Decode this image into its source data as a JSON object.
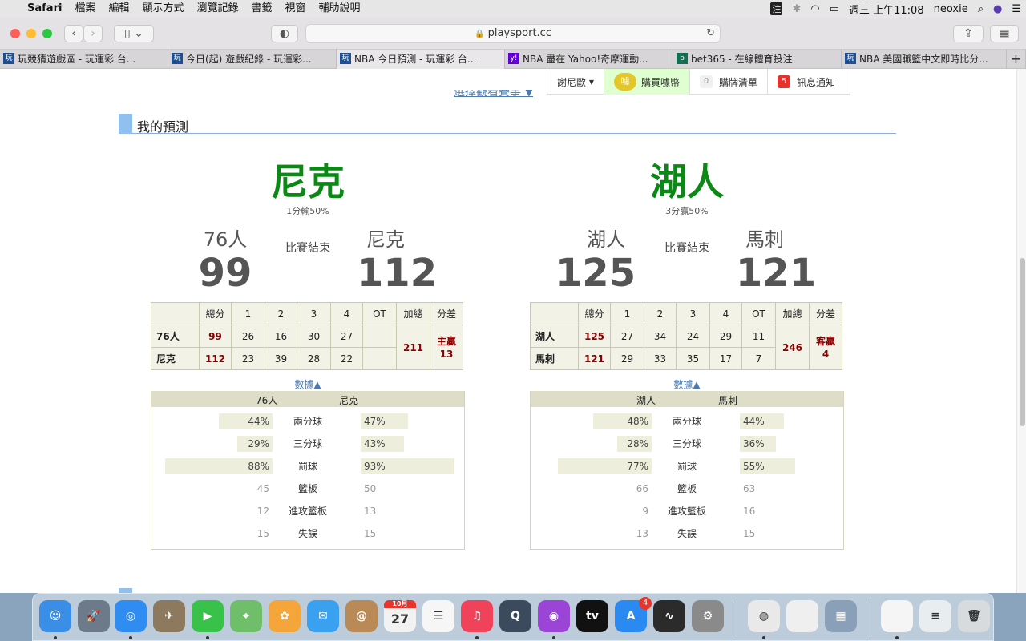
{
  "menubar": {
    "apple": "",
    "app": "Safari",
    "items": [
      "檔案",
      "編輯",
      "顯示方式",
      "瀏覽記錄",
      "書籤",
      "視窗",
      "輔助說明"
    ],
    "input_method": "注",
    "clock": "週三 上午11:08",
    "user": "neoxie"
  },
  "browser": {
    "url": "playsport.cc",
    "tabs": [
      {
        "label": "玩競猜遊戲區 - 玩運彩 台...",
        "favicon": "玩"
      },
      {
        "label": "今日(起) 遊戲紀錄 - 玩運彩...",
        "favicon": "玩"
      },
      {
        "label": "NBA 今日預測 - 玩運彩 台...",
        "favicon": "玩"
      },
      {
        "label": "NBA 盡在 Yahoo!奇摩運動...",
        "favicon": "y!"
      },
      {
        "label": "bet365 - 在線體育投注",
        "favicon": "b"
      },
      {
        "label": "NBA 美國職籃中文即時比分...",
        "favicon": "玩"
      }
    ]
  },
  "site": {
    "nav": {
      "user": "謝尼歐",
      "buy": "購買噱幣",
      "buy_icon": "噱",
      "cart_count": "0",
      "cart": "購牌清單",
      "notify_count": "5",
      "notify": "訊息通知"
    },
    "cut_link": "選擇觀看賽事 ▼",
    "section_title": "我的預測",
    "data_toggle": "數據▲"
  },
  "games": [
    {
      "pick": "尼克",
      "pick_sub": "1分輸50%",
      "status": "比賽結束",
      "away": {
        "name": "76人",
        "score": "99"
      },
      "home": {
        "name": "尼克",
        "score": "112"
      },
      "headers": [
        "",
        "總分",
        "1",
        "2",
        "3",
        "4",
        "OT",
        "加總",
        "分差"
      ],
      "rows": [
        {
          "team": "76人",
          "total": "99",
          "q": [
            "26",
            "16",
            "30",
            "27",
            ""
          ]
        },
        {
          "team": "尼克",
          "total": "112",
          "q": [
            "23",
            "39",
            "28",
            "22",
            ""
          ]
        }
      ],
      "sum": "211",
      "diff_label": "主贏",
      "diff_value": "13",
      "stat_head_left": "76人",
      "stat_head_right": "尼克",
      "stats": [
        {
          "name": "兩分球",
          "left": "44%",
          "right": "47%",
          "left_frac": 0.44,
          "right_frac": 0.47,
          "bar": true
        },
        {
          "name": "三分球",
          "left": "29%",
          "right": "43%",
          "left_frac": 0.29,
          "right_frac": 0.43,
          "bar": true
        },
        {
          "name": "罰球",
          "left": "88%",
          "right": "93%",
          "left_frac": 0.88,
          "right_frac": 0.93,
          "bar": true
        },
        {
          "name": "籃板",
          "left": "45",
          "right": "50",
          "bar": false
        },
        {
          "name": "進攻籃板",
          "left": "12",
          "right": "13",
          "bar": false
        },
        {
          "name": "失誤",
          "left": "15",
          "right": "15",
          "bar": false
        }
      ]
    },
    {
      "pick": "湖人",
      "pick_sub": "3分贏50%",
      "status": "比賽結束",
      "away": {
        "name": "湖人",
        "score": "125"
      },
      "home": {
        "name": "馬刺",
        "score": "121"
      },
      "headers": [
        "",
        "總分",
        "1",
        "2",
        "3",
        "4",
        "OT",
        "加總",
        "分差"
      ],
      "rows": [
        {
          "team": "湖人",
          "total": "125",
          "q": [
            "27",
            "34",
            "24",
            "29",
            "11"
          ]
        },
        {
          "team": "馬刺",
          "total": "121",
          "q": [
            "29",
            "33",
            "35",
            "17",
            "7"
          ]
        }
      ],
      "sum": "246",
      "diff_label": "客贏",
      "diff_value": "4",
      "stat_head_left": "湖人",
      "stat_head_right": "馬刺",
      "stats": [
        {
          "name": "兩分球",
          "left": "48%",
          "right": "44%",
          "left_frac": 0.48,
          "right_frac": 0.44,
          "bar": true
        },
        {
          "name": "三分球",
          "left": "28%",
          "right": "36%",
          "left_frac": 0.28,
          "right_frac": 0.36,
          "bar": true
        },
        {
          "name": "罰球",
          "left": "77%",
          "right": "55%",
          "left_frac": 0.77,
          "right_frac": 0.55,
          "bar": true
        },
        {
          "name": "籃板",
          "left": "66",
          "right": "63",
          "bar": false
        },
        {
          "name": "進攻籃板",
          "left": "9",
          "right": "16",
          "bar": false
        },
        {
          "name": "失誤",
          "left": "13",
          "right": "15",
          "bar": false
        }
      ]
    }
  ],
  "dock": {
    "apps": [
      {
        "name": "finder",
        "color": "#3a8ee6",
        "glyph": "☺"
      },
      {
        "name": "launchpad",
        "color": "#6c7a89",
        "glyph": "🚀"
      },
      {
        "name": "safari",
        "color": "#2f8cf0",
        "glyph": "◎"
      },
      {
        "name": "preview-eagle",
        "color": "#8d7a5e",
        "glyph": "✈"
      },
      {
        "name": "facetime",
        "color": "#39c24a",
        "glyph": "▶"
      },
      {
        "name": "maps",
        "color": "#6fbf6a",
        "glyph": "⌖"
      },
      {
        "name": "photos",
        "color": "#f4a63a",
        "glyph": "✿"
      },
      {
        "name": "messages",
        "color": "#3aa0f0",
        "glyph": "✉"
      },
      {
        "name": "contacts",
        "color": "#b98a55",
        "glyph": "@"
      },
      {
        "name": "calendar",
        "color": "#f2f2f2",
        "glyph": "27"
      },
      {
        "name": "reminders",
        "color": "#f6f6f6",
        "glyph": "☰"
      },
      {
        "name": "music",
        "color": "#f0435a",
        "glyph": "♫"
      },
      {
        "name": "quicktime",
        "color": "#3b4a5c",
        "glyph": "Q"
      },
      {
        "name": "podcasts",
        "color": "#9a45d6",
        "glyph": "◉"
      },
      {
        "name": "tv",
        "color": "#111111",
        "glyph": "tv"
      },
      {
        "name": "app-store",
        "color": "#2a8af2",
        "glyph": "A"
      },
      {
        "name": "voice-memos",
        "color": "#2b2b2b",
        "glyph": "∿"
      },
      {
        "name": "system-preferences",
        "color": "#8a8a8a",
        "glyph": "⚙"
      },
      {
        "name": "chrome",
        "color": "#e9e9e9",
        "glyph": "◍"
      },
      {
        "name": "document",
        "color": "#efefef",
        "glyph": ""
      },
      {
        "name": "image-preview",
        "color": "#8aa0b8",
        "glyph": "▦"
      },
      {
        "name": "file",
        "color": "#f5f5f5",
        "glyph": ""
      },
      {
        "name": "stack",
        "color": "#e8eef0",
        "glyph": "≡"
      },
      {
        "name": "trash",
        "color": "#d8dbde",
        "glyph": "🗑"
      }
    ],
    "calendar_month": "10月",
    "app_store_badge": "4"
  }
}
